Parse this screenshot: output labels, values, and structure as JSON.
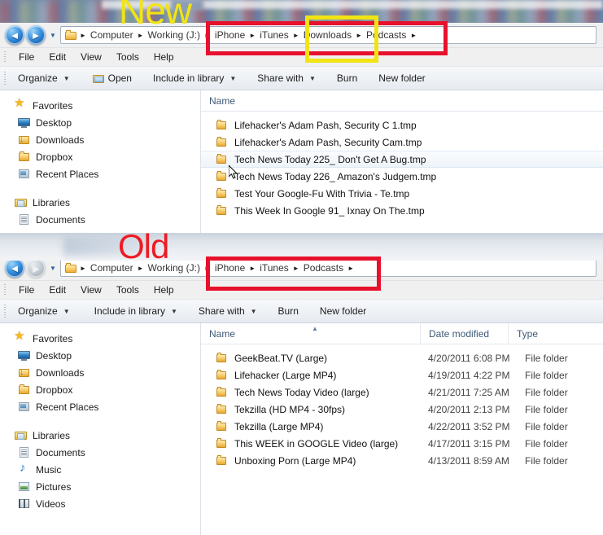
{
  "annotations": {
    "new_label": "New",
    "old_label": "Old",
    "new_label_color": "#f2e414",
    "old_label_color": "#ee1b24",
    "red_box_color": "#e8112d",
    "yellow_box_color": "#f2e414"
  },
  "new_window": {
    "nav": {
      "back": "◄",
      "forward": "►",
      "history_dropdown": "▼"
    },
    "address": {
      "folder_icon": "folder-icon",
      "crumbs": [
        "Computer",
        "Working (J:)",
        "iPhone",
        "iTunes",
        "Downloads",
        "Podcasts"
      ],
      "separator": "►"
    },
    "menubar": [
      "File",
      "Edit",
      "View",
      "Tools",
      "Help"
    ],
    "toolbar": [
      {
        "label": "Organize",
        "caret": "▼",
        "icon": ""
      },
      {
        "label": "Open",
        "caret": "",
        "icon": "open-folder-icon"
      },
      {
        "label": "Include in library",
        "caret": "▼",
        "icon": ""
      },
      {
        "label": "Share with",
        "caret": "▼",
        "icon": ""
      },
      {
        "label": "Burn",
        "caret": "",
        "icon": ""
      },
      {
        "label": "New folder",
        "caret": "",
        "icon": ""
      }
    ],
    "sidebar": [
      {
        "label": "Favorites",
        "icon": "star-icon",
        "level": "root"
      },
      {
        "label": "Desktop",
        "icon": "desktop-icon",
        "level": "child"
      },
      {
        "label": "Downloads",
        "icon": "downloads-folder-icon",
        "level": "child"
      },
      {
        "label": "Dropbox",
        "icon": "folder-icon",
        "level": "child"
      },
      {
        "label": "Recent Places",
        "icon": "recent-places-icon",
        "level": "child"
      },
      {
        "label": "Libraries",
        "icon": "libraries-icon",
        "level": "root"
      },
      {
        "label": "Documents",
        "icon": "document-icon",
        "level": "child"
      }
    ],
    "columns": [
      "Name"
    ],
    "rows": [
      {
        "name": "Lifehacker's Adam Pash, Security C 1.tmp",
        "selected": false
      },
      {
        "name": "Lifehacker's Adam Pash, Security Cam.tmp",
        "selected": false
      },
      {
        "name": "Tech News Today 225_ Don't Get A Bug.tmp",
        "selected": true
      },
      {
        "name": "Tech News Today 226_ Amazon's Judgem.tmp",
        "selected": false
      },
      {
        "name": "Test Your Google-Fu With Trivia - Te.tmp",
        "selected": false
      },
      {
        "name": "This Week In Google 91_ Ixnay On The.tmp",
        "selected": false
      }
    ]
  },
  "old_window": {
    "nav": {
      "back": "◄",
      "forward": "►",
      "history_dropdown": "▼"
    },
    "address": {
      "folder_icon": "folder-icon",
      "crumbs": [
        "Computer",
        "Working (J:)",
        "iPhone",
        "iTunes",
        "Podcasts"
      ],
      "separator": "►"
    },
    "menubar": [
      "File",
      "Edit",
      "View",
      "Tools",
      "Help"
    ],
    "toolbar": [
      {
        "label": "Organize",
        "caret": "▼",
        "icon": ""
      },
      {
        "label": "Include in library",
        "caret": "▼",
        "icon": ""
      },
      {
        "label": "Share with",
        "caret": "▼",
        "icon": ""
      },
      {
        "label": "Burn",
        "caret": "",
        "icon": ""
      },
      {
        "label": "New folder",
        "caret": "",
        "icon": ""
      }
    ],
    "sidebar": [
      {
        "label": "Favorites",
        "icon": "star-icon",
        "level": "root"
      },
      {
        "label": "Desktop",
        "icon": "desktop-icon",
        "level": "child"
      },
      {
        "label": "Downloads",
        "icon": "downloads-folder-icon",
        "level": "child"
      },
      {
        "label": "Dropbox",
        "icon": "folder-icon",
        "level": "child"
      },
      {
        "label": "Recent Places",
        "icon": "recent-places-icon",
        "level": "child"
      },
      {
        "label": "Libraries",
        "icon": "libraries-icon",
        "level": "root"
      },
      {
        "label": "Documents",
        "icon": "document-icon",
        "level": "child"
      },
      {
        "label": "Music",
        "icon": "music-icon",
        "level": "child"
      },
      {
        "label": "Pictures",
        "icon": "pictures-icon",
        "level": "child"
      },
      {
        "label": "Videos",
        "icon": "videos-icon",
        "level": "child"
      }
    ],
    "columns": [
      "Name",
      "Date modified",
      "Type"
    ],
    "sort_indicator": "▲",
    "rows": [
      {
        "name": "GeekBeat.TV (Large)",
        "date": "4/20/2011 6:08 PM",
        "type": "File folder"
      },
      {
        "name": "Lifehacker (Large MP4)",
        "date": "4/19/2011 4:22 PM",
        "type": "File folder"
      },
      {
        "name": "Tech News Today Video (large)",
        "date": "4/21/2011 7:25 AM",
        "type": "File folder"
      },
      {
        "name": "Tekzilla (HD MP4 - 30fps)",
        "date": "4/20/2011 2:13 PM",
        "type": "File folder"
      },
      {
        "name": "Tekzilla (Large MP4)",
        "date": "4/22/2011 3:52 PM",
        "type": "File folder"
      },
      {
        "name": "This WEEK in GOOGLE Video (large)",
        "date": "4/17/2011 3:15 PM",
        "type": "File folder"
      },
      {
        "name": "Unboxing Porn (Large MP4)",
        "date": "4/13/2011 8:59 AM",
        "type": "File folder"
      }
    ]
  }
}
